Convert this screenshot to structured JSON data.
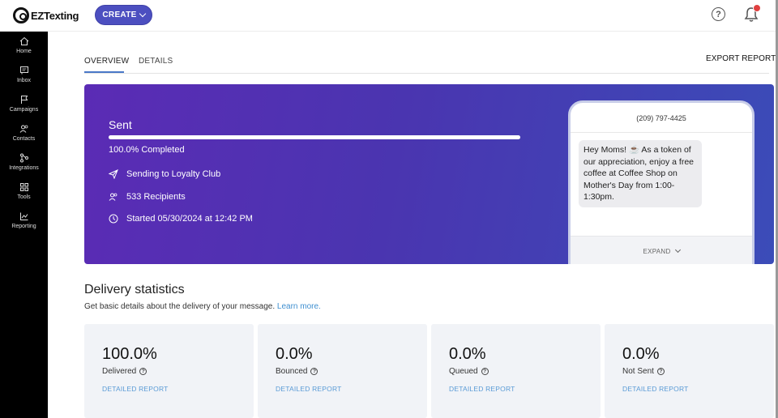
{
  "brand": {
    "name": "EZTexting"
  },
  "topbar": {
    "create_label": "CREATE",
    "help_symbol": "?"
  },
  "sidebar": {
    "items": [
      {
        "label": "Home",
        "icon": "home-icon"
      },
      {
        "label": "Inbox",
        "icon": "inbox-icon"
      },
      {
        "label": "Campaigns",
        "icon": "flag-icon"
      },
      {
        "label": "Contacts",
        "icon": "users-icon"
      },
      {
        "label": "Integrations",
        "icon": "integrations-icon"
      },
      {
        "label": "Tools",
        "icon": "tools-icon"
      },
      {
        "label": "Reporting",
        "icon": "reporting-icon"
      }
    ]
  },
  "tabs": [
    {
      "label": "OVERVIEW",
      "active": true
    },
    {
      "label": "DETAILS",
      "active": false
    }
  ],
  "export_label": "EXPORT REPORT",
  "hero": {
    "status": "Sent",
    "progress": 100,
    "completed_text": "100.0% Completed",
    "sending_to": "Sending to Loyalty Club",
    "recipients": "533 Recipients",
    "started": "Started 05/30/2024 at 12:42 PM"
  },
  "phone": {
    "number": "(209) 797-4425",
    "message": "Hey Moms! ☕ As a token of our appreciation, enjoy a free coffee at Coffee Shop on Mother's Day from 1:00-1:30pm.",
    "expand_label": "EXPAND"
  },
  "delivery": {
    "title": "Delivery statistics",
    "subtitle": "Get basic details about the delivery of your message.",
    "learn_more": "Learn more.",
    "cards": [
      {
        "value": "100.0%",
        "label": "Delivered",
        "link": "DETAILED REPORT"
      },
      {
        "value": "0.0%",
        "label": "Bounced",
        "link": "DETAILED REPORT"
      },
      {
        "value": "0.0%",
        "label": "Queued",
        "link": "DETAILED REPORT"
      },
      {
        "value": "0.0%",
        "label": "Not Sent",
        "link": "DETAILED REPORT"
      }
    ]
  },
  "colors": {
    "accent": "#4c4fc0",
    "link": "#3f8fd0",
    "hero_start": "#5b2bb5",
    "hero_end": "#3b4cb8"
  }
}
